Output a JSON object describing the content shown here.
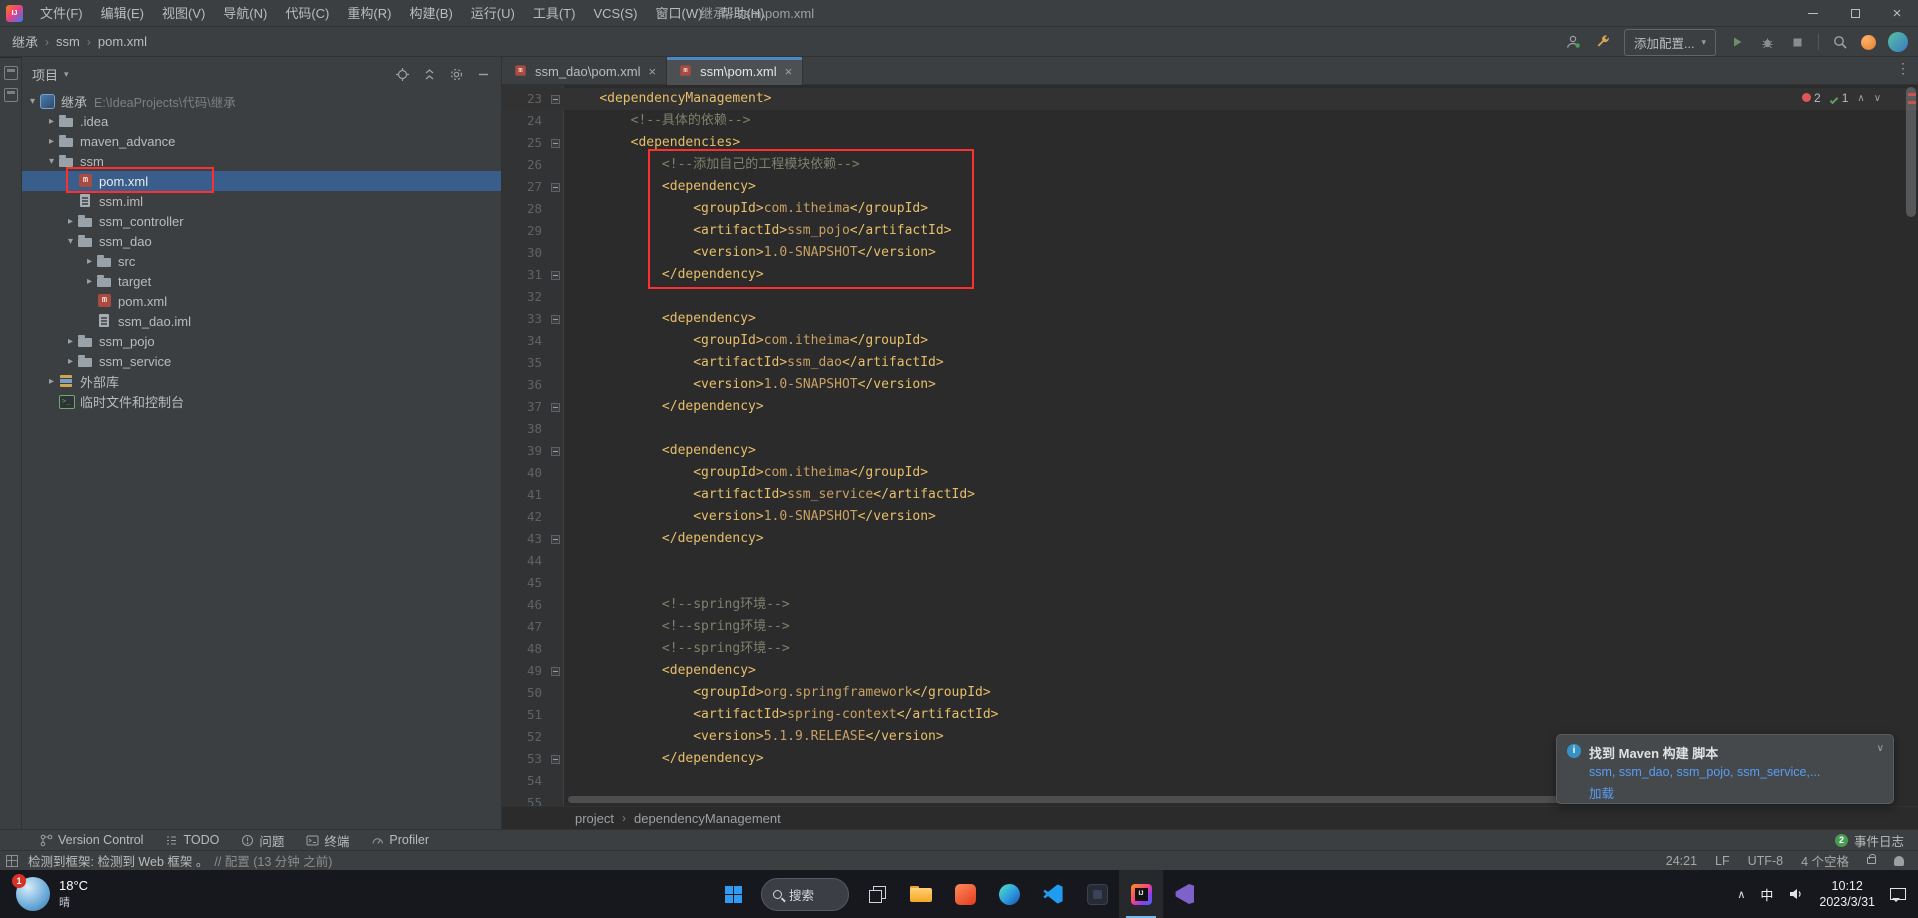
{
  "colors": {
    "annotation_red": "#ff2f2f",
    "selection_blue": "#3a5e8c",
    "xml_tag": "#e8bf6a",
    "xml_text": "#c8a063",
    "xml_comment": "#80806e",
    "link_blue": "#589df6"
  },
  "titlebar": {
    "title": "继承 - ssm\\pom.xml",
    "menus": [
      "文件(F)",
      "编辑(E)",
      "视图(V)",
      "导航(N)",
      "代码(C)",
      "重构(R)",
      "构建(B)",
      "运行(U)",
      "工具(T)",
      "VCS(S)",
      "窗口(W)",
      "帮助(H)"
    ]
  },
  "toolbar": {
    "breadcrumbs": [
      "继承",
      "ssm",
      "pom.xml"
    ],
    "add_config": "添加配置..."
  },
  "stripe": {
    "favorites": "收藏",
    "bookmarks": "Bookmarks"
  },
  "project": {
    "header": "项目",
    "tree": [
      {
        "label": "继承",
        "path": "E:\\IdeaProjects\\代码\\继承",
        "level": 0,
        "arrow": "down",
        "icon": "project"
      },
      {
        "label": ".idea",
        "level": 1,
        "arrow": "right",
        "icon": "folder"
      },
      {
        "label": "maven_advance",
        "level": 1,
        "arrow": "right",
        "icon": "folder"
      },
      {
        "label": "ssm",
        "level": 1,
        "arrow": "down",
        "icon": "folder"
      },
      {
        "label": "pom.xml",
        "level": 2,
        "arrow": "",
        "icon": "maven",
        "selected": true
      },
      {
        "label": "ssm.iml",
        "level": 2,
        "arrow": "",
        "icon": "iml"
      },
      {
        "label": "ssm_controller",
        "level": 2,
        "arrow": "right",
        "icon": "folder"
      },
      {
        "label": "ssm_dao",
        "level": 2,
        "arrow": "down",
        "icon": "folder"
      },
      {
        "label": "src",
        "level": 3,
        "arrow": "right",
        "icon": "folder"
      },
      {
        "label": "target",
        "level": 3,
        "arrow": "right",
        "icon": "folder"
      },
      {
        "label": "pom.xml",
        "level": 3,
        "arrow": "",
        "icon": "maven"
      },
      {
        "label": "ssm_dao.iml",
        "level": 3,
        "arrow": "",
        "icon": "iml"
      },
      {
        "label": "ssm_pojo",
        "level": 2,
        "arrow": "right",
        "icon": "folder"
      },
      {
        "label": "ssm_service",
        "level": 2,
        "arrow": "right",
        "icon": "folder"
      },
      {
        "label": "外部库",
        "level": 1,
        "arrow": "right",
        "icon": "lib"
      },
      {
        "label": "临时文件和控制台",
        "level": 1,
        "arrow": "",
        "icon": "console"
      }
    ]
  },
  "editor": {
    "tabs": [
      {
        "label": "ssm_dao\\pom.xml",
        "active": false
      },
      {
        "label": "ssm\\pom.xml",
        "active": true
      }
    ],
    "inspections": {
      "errors": "2",
      "clean": "1"
    },
    "breadcrumb": [
      "project",
      "dependencyManagement"
    ],
    "lines": [
      {
        "n": 23,
        "i": 1,
        "fold": "open",
        "cur": true,
        "seg": [
          [
            "t",
            "<dependencyManagement>"
          ]
        ]
      },
      {
        "n": 24,
        "i": 2,
        "seg": [
          [
            "c",
            "<!--具体的依赖-->"
          ]
        ]
      },
      {
        "n": 25,
        "i": 2,
        "fold": "open",
        "seg": [
          [
            "t",
            "<dependencies>"
          ]
        ]
      },
      {
        "n": 26,
        "i": 3,
        "seg": [
          [
            "c",
            "<!--添加自己的工程模块依赖-->"
          ]
        ]
      },
      {
        "n": 27,
        "i": 3,
        "fold": "open",
        "seg": [
          [
            "t",
            "<dependency>"
          ]
        ]
      },
      {
        "n": 28,
        "i": 4,
        "seg": [
          [
            "t",
            "<groupId>"
          ],
          [
            "x",
            "com.itheima"
          ],
          [
            "t",
            "</groupId>"
          ]
        ]
      },
      {
        "n": 29,
        "i": 4,
        "seg": [
          [
            "t",
            "<artifactId>"
          ],
          [
            "x",
            "ssm_pojo"
          ],
          [
            "t",
            "</artifactId>"
          ]
        ]
      },
      {
        "n": 30,
        "i": 4,
        "seg": [
          [
            "t",
            "<version>"
          ],
          [
            "x",
            "1.0-SNAPSHOT"
          ],
          [
            "t",
            "</version>"
          ]
        ]
      },
      {
        "n": 31,
        "i": 3,
        "fold": "close",
        "seg": [
          [
            "t",
            "</dependency>"
          ]
        ]
      },
      {
        "n": 32,
        "i": 0,
        "seg": []
      },
      {
        "n": 33,
        "i": 3,
        "fold": "open",
        "seg": [
          [
            "t",
            "<dependency>"
          ]
        ]
      },
      {
        "n": 34,
        "i": 4,
        "seg": [
          [
            "t",
            "<groupId>"
          ],
          [
            "x",
            "com.itheima"
          ],
          [
            "t",
            "</groupId>"
          ]
        ]
      },
      {
        "n": 35,
        "i": 4,
        "seg": [
          [
            "t",
            "<artifactId>"
          ],
          [
            "x",
            "ssm_dao"
          ],
          [
            "t",
            "</artifactId>"
          ]
        ]
      },
      {
        "n": 36,
        "i": 4,
        "seg": [
          [
            "t",
            "<version>"
          ],
          [
            "x",
            "1.0-SNAPSHOT"
          ],
          [
            "t",
            "</version>"
          ]
        ]
      },
      {
        "n": 37,
        "i": 3,
        "fold": "close",
        "seg": [
          [
            "t",
            "</dependency>"
          ]
        ]
      },
      {
        "n": 38,
        "i": 0,
        "seg": []
      },
      {
        "n": 39,
        "i": 3,
        "fold": "open",
        "seg": [
          [
            "t",
            "<dependency>"
          ]
        ]
      },
      {
        "n": 40,
        "i": 4,
        "seg": [
          [
            "t",
            "<groupId>"
          ],
          [
            "x",
            "com.itheima"
          ],
          [
            "t",
            "</groupId>"
          ]
        ]
      },
      {
        "n": 41,
        "i": 4,
        "seg": [
          [
            "t",
            "<artifactId>"
          ],
          [
            "x",
            "ssm_service"
          ],
          [
            "t",
            "</artifactId>"
          ]
        ]
      },
      {
        "n": 42,
        "i": 4,
        "seg": [
          [
            "t",
            "<version>"
          ],
          [
            "x",
            "1.0-SNAPSHOT"
          ],
          [
            "t",
            "</version>"
          ]
        ]
      },
      {
        "n": 43,
        "i": 3,
        "fold": "close",
        "seg": [
          [
            "t",
            "</dependency>"
          ]
        ]
      },
      {
        "n": 44,
        "i": 0,
        "seg": []
      },
      {
        "n": 45,
        "i": 0,
        "seg": []
      },
      {
        "n": 46,
        "i": 3,
        "seg": [
          [
            "c",
            "<!--spring环境-->"
          ]
        ]
      },
      {
        "n": 47,
        "i": 3,
        "seg": [
          [
            "c",
            "<!--spring环境-->"
          ]
        ]
      },
      {
        "n": 48,
        "i": 3,
        "seg": [
          [
            "c",
            "<!--spring环境-->"
          ]
        ]
      },
      {
        "n": 49,
        "i": 3,
        "fold": "open",
        "seg": [
          [
            "t",
            "<dependency>"
          ]
        ]
      },
      {
        "n": 50,
        "i": 4,
        "seg": [
          [
            "t",
            "<groupId>"
          ],
          [
            "x",
            "org.springframework"
          ],
          [
            "t",
            "</groupId>"
          ]
        ]
      },
      {
        "n": 51,
        "i": 4,
        "seg": [
          [
            "t",
            "<artifactId>"
          ],
          [
            "x",
            "spring-context"
          ],
          [
            "t",
            "</artifactId>"
          ]
        ]
      },
      {
        "n": 52,
        "i": 4,
        "seg": [
          [
            "t",
            "<version>"
          ],
          [
            "x",
            "5.1.9.RELEASE"
          ],
          [
            "t",
            "</version>"
          ]
        ]
      },
      {
        "n": 53,
        "i": 3,
        "fold": "close",
        "seg": [
          [
            "t",
            "</dependency>"
          ]
        ]
      },
      {
        "n": 54,
        "i": 0,
        "seg": []
      },
      {
        "n": 55,
        "i": 0,
        "seg": []
      }
    ]
  },
  "notification": {
    "title": "找到 Maven 构建 脚本",
    "modules": "ssm, ssm_dao, ssm_pojo, ssm_service,...",
    "action": "加载"
  },
  "tool_buttons": {
    "items": [
      {
        "icon": "vcs",
        "label": "Version Control"
      },
      {
        "icon": "todo",
        "label": "TODO"
      },
      {
        "icon": "problems",
        "label": "问题"
      },
      {
        "icon": "terminal",
        "label": "终端"
      },
      {
        "icon": "profiler",
        "label": "Profiler"
      }
    ],
    "event_log_count": "2",
    "event_log": "事件日志"
  },
  "statusbar": {
    "message": "检测到框架: 检测到 Web 框架 。",
    "config": "// 配置 (13 分钟 之前)",
    "caret": "24:21",
    "line_ending": "LF",
    "encoding": "UTF-8",
    "indent": "4 个空格"
  },
  "taskbar": {
    "weather_temp": "18°C",
    "weather_desc": "晴",
    "weather_badge": "1",
    "search": "搜索",
    "ime": "中",
    "time": "10:12",
    "date": "2023/3/31"
  }
}
